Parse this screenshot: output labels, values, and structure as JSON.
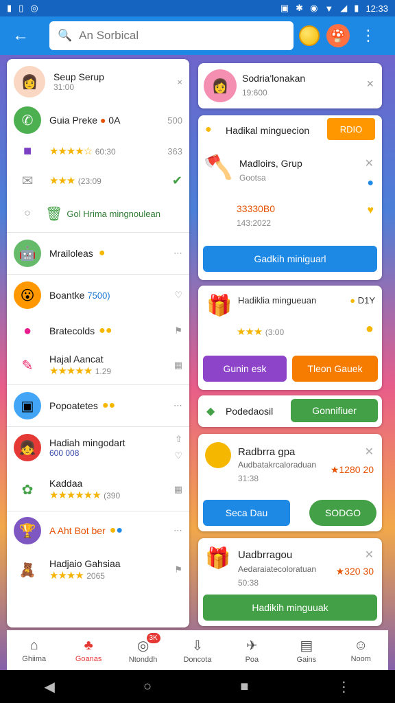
{
  "status": {
    "time": "12:33",
    "icons_left": [
      "sim-icon",
      "notification-icon",
      "sync-icon"
    ],
    "icons_right": [
      "nfc-icon",
      "bluetooth-icon",
      "alarm-icon",
      "wifi-icon",
      "signal-icon",
      "battery-icon"
    ]
  },
  "topbar": {
    "search_placeholder": "An Sorbical"
  },
  "left": {
    "rows": [
      {
        "title": "Seup Serup",
        "sub": "31:00"
      },
      {
        "title": "Guia Preke",
        "badge": "0A",
        "side": "500"
      },
      {
        "rating": "60:30",
        "side": "363",
        "stars": 4
      },
      {
        "rating": "(23:09",
        "stars": 3
      },
      {
        "green": "Gol Hrima mingnoulean"
      },
      {
        "title": "Mrailoleas"
      },
      {
        "title": "Boantke",
        "blue": "7500)"
      },
      {
        "title": "Bratecolds"
      },
      {
        "title": "Hajal Aancat",
        "rating": "1.29",
        "stars": 5
      },
      {
        "title": "Popoatetes"
      },
      {
        "title": "Hadiah mingodart",
        "num": "600 008"
      },
      {
        "title": "Kaddaa",
        "rating": "(390",
        "stars": 6
      },
      {
        "title": "A Aht Bot ber"
      },
      {
        "title": "Hadjaio Gahsiaa",
        "rating": "2065",
        "stars": 4
      }
    ]
  },
  "right": {
    "profile": {
      "name": "Sodria'lonakan",
      "sub": "19:600"
    },
    "card1": {
      "header": "Hadikal minguecion",
      "tag": "RDIO",
      "title": "Madloirs, Grup",
      "sub": "Gootsa",
      "price": "33330B0",
      "date": "143:2022",
      "button": "Gadkih miniguarl"
    },
    "card2": {
      "title": "Hadiklia mingueuan",
      "badge": "D1Y",
      "rating": "(3:00",
      "btn_left": "Gunin esk",
      "btn_right": "Tleon Gauek"
    },
    "card3": {
      "label": "Podedaosil",
      "button": "Gonnifiuer"
    },
    "card4": {
      "title": "Radbrra gpa",
      "sub": "Audbatakrcaloraduan",
      "price": "1280 20",
      "date": "31:38",
      "btn_left": "Seca Dau",
      "btn_right": "SODGO"
    },
    "card5": {
      "title": "Uadbrragou",
      "sub": "Aedaraiatecoloratuan",
      "price": "320 30",
      "date": "50:38",
      "button": "Hadikih minguuak"
    }
  },
  "nav": [
    {
      "label": "Ghiima"
    },
    {
      "label": "Goanas"
    },
    {
      "label": "Ntonddh",
      "badge": "3K"
    },
    {
      "label": "Doncota"
    },
    {
      "label": "Poa"
    },
    {
      "label": "Gains"
    },
    {
      "label": "Noom"
    }
  ],
  "colors": {
    "primary": "#1e88e5",
    "green": "#43a047",
    "purple": "#8e44c9",
    "orange": "#f57c00"
  }
}
